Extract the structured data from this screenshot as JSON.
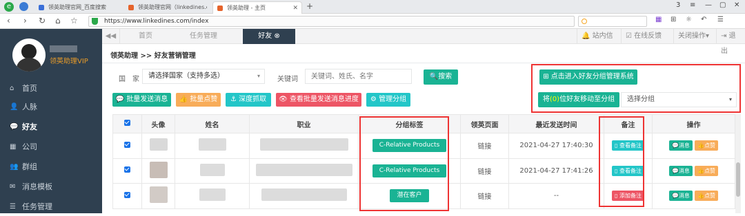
{
  "browser": {
    "tabs": [
      {
        "label": "领英助理官网_百度搜索",
        "color": "#3a6fd8"
      },
      {
        "label": "领英助理官网（linkedines.com",
        "color": "#e5632b"
      },
      {
        "label": "领英助理 - 主页",
        "color": "#e5632b"
      }
    ],
    "url": "https://www.linkedines.com/index",
    "window_badge": "3"
  },
  "sidebar": {
    "vip": "领英助理VIP",
    "items": [
      {
        "icon": "home-icon",
        "glyph": "⌂",
        "label": "首页"
      },
      {
        "icon": "contacts-icon",
        "glyph": "👤",
        "label": "人脉"
      },
      {
        "icon": "chat-icon",
        "glyph": "💬",
        "label": "好友"
      },
      {
        "icon": "building-icon",
        "glyph": "▦",
        "label": "公司"
      },
      {
        "icon": "group-icon",
        "glyph": "👥",
        "label": "群组"
      },
      {
        "icon": "mail-icon",
        "glyph": "✉",
        "label": "消息模板"
      },
      {
        "icon": "list-icon",
        "glyph": "☰",
        "label": "任务管理"
      }
    ]
  },
  "topnav": {
    "back": "◀◀",
    "tabs": [
      {
        "label": "首页"
      },
      {
        "label": "任务管理"
      },
      {
        "label": "好友"
      }
    ],
    "right": [
      "站内信",
      "在线反馈",
      "关闭操作▾",
      "退出"
    ]
  },
  "breadcrumb": "领英助理 >> 好友营销管理",
  "filters": {
    "country_label": "国　家",
    "country_placeholder": "请选择国家（支持多选）",
    "keyword_label": "关键词",
    "keyword_placeholder": "关键词、姓氏、名字",
    "search_button": "搜索"
  },
  "actions": {
    "batch_message": "批量发送消息",
    "batch_like": "批量点赞",
    "deep_crawl": "深度抓取",
    "view_progress": "查看批量发送消息进度",
    "manage_groups": "管理分组"
  },
  "group_panel": {
    "enter_button": "点击进入好友分组管理系统",
    "move_prefix": "将",
    "move_count": "(0)",
    "move_suffix": "位好友移动至分组",
    "select_placeholder": "选择分组"
  },
  "table": {
    "headers": [
      "头像",
      "姓名",
      "职业",
      "分组标签",
      "领英页面",
      "最近发送时间",
      "备注",
      "操作"
    ],
    "rows": [
      {
        "tag": "C-Relative Products",
        "link": "链接",
        "time": "2021-04-27 17:40:30",
        "note": "查看备注",
        "note_color": "#23c6c8",
        "msg": "消息",
        "like": "点赞"
      },
      {
        "tag": "C-Relative Products",
        "link": "链接",
        "time": "2021-04-27 17:41:26",
        "note": "查看备注",
        "note_color": "#23c6c8",
        "msg": "消息",
        "like": "点赞"
      },
      {
        "tag": "潜在客户",
        "link": "链接",
        "time": "--",
        "note": "添加备注",
        "note_color": "#ed5565",
        "msg": "消息",
        "like": "点赞"
      }
    ]
  }
}
